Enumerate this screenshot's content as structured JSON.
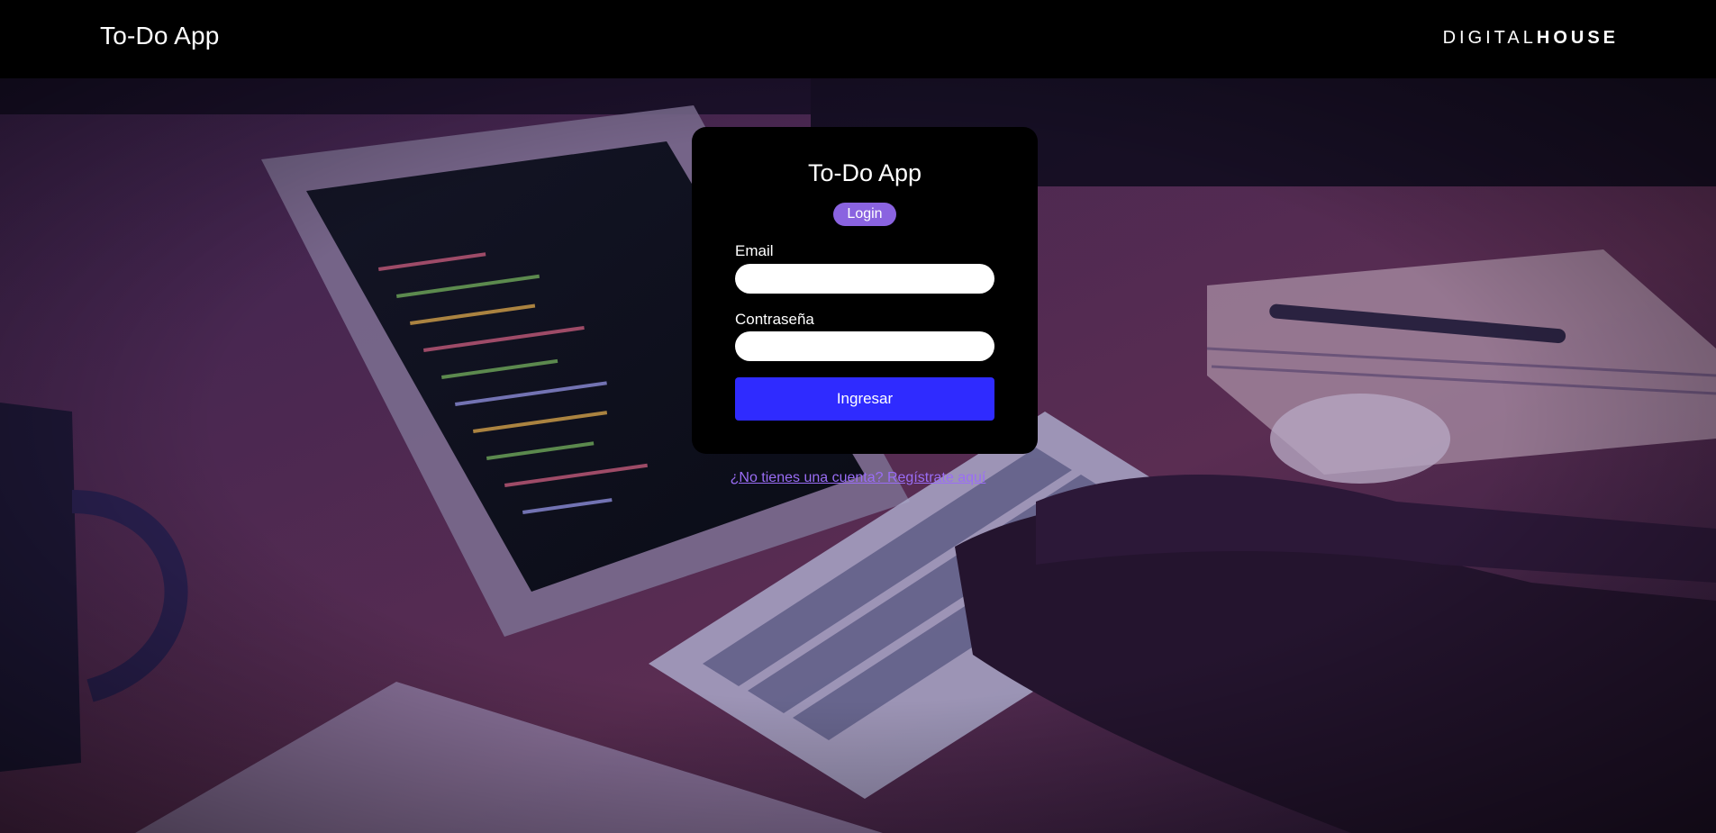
{
  "header": {
    "app_title": "To-Do App",
    "brand_light": "DIGITAL",
    "brand_bold": "HOUSE"
  },
  "login_card": {
    "title": "To-Do App",
    "badge": "Login",
    "email_label": "Email",
    "email_value": "",
    "password_label": "Contraseña",
    "password_value": "",
    "submit_label": "Ingresar"
  },
  "register_link": "¿No tienes una cuenta? Regístrate aquí",
  "colors": {
    "header_bg": "#000000",
    "card_bg": "#000000",
    "badge": "#8a63e0",
    "button": "#2f2bff",
    "link": "#9a6df5"
  }
}
